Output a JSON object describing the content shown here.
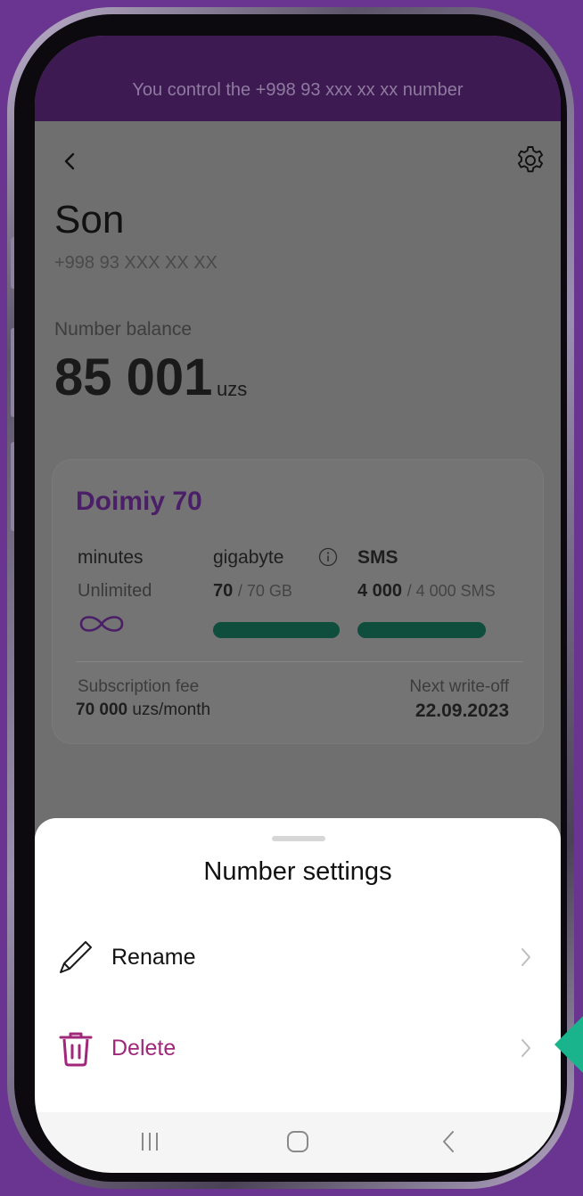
{
  "banner": {
    "text": "You control the +998 93 xxx xx xx number"
  },
  "profile": {
    "name": "Son",
    "number": "+998 93 XXX XX XX"
  },
  "balance": {
    "label": "Number balance",
    "value": "85 001",
    "unit": "uzs"
  },
  "plan": {
    "name": "Doimiy 70",
    "minutes": {
      "title": "minutes",
      "value": "Unlimited"
    },
    "gigabyte": {
      "title": "gigabyte",
      "used": "70",
      "total": "/ 70 GB",
      "fill": 1.0
    },
    "sms": {
      "title": "SMS",
      "used": "4 000",
      "total": "/ 4 000 SMS",
      "fill": 1.0
    },
    "fee": {
      "label": "Subscription fee",
      "amount": "70 000",
      "unit": "uzs/month"
    },
    "writeoff": {
      "label": "Next write-off",
      "date": "22.09.2023"
    }
  },
  "sheet": {
    "title": "Number settings",
    "items": [
      {
        "label": "Rename",
        "icon": "pencil-icon"
      },
      {
        "label": "Delete",
        "icon": "trash-icon"
      }
    ]
  },
  "colors": {
    "brand": "#3d1a52",
    "plan_title": "#4a1f68",
    "progress": "#0f4d3d",
    "delete": "#a0287a",
    "pointer": "#19b38c"
  },
  "navbar": {
    "icons": [
      "recent-apps-icon",
      "home-icon",
      "back-icon"
    ]
  }
}
